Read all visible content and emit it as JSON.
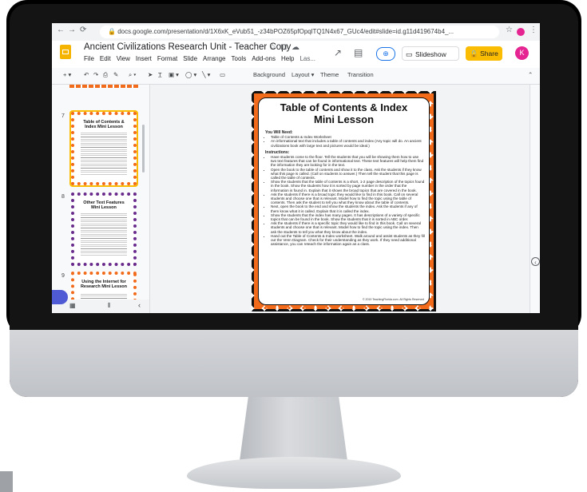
{
  "browser": {
    "url": "docs.google.com/presentation/d/1X6xK_eVub51_-z34bPOZ65pfOpqlTQ1N4x67_GUc4/edit#slide=id.g11d419674b4_...",
    "nav": [
      "←",
      "→",
      "⟳"
    ]
  },
  "app": {
    "title": "Ancient Civilizations Research Unit - Teacher Copy",
    "menu": [
      "File",
      "Edit",
      "View",
      "Insert",
      "Format",
      "Slide",
      "Arrange",
      "Tools",
      "Add-ons",
      "Help",
      "Las..."
    ],
    "slideshow_label": "Slideshow",
    "share_label": "Share",
    "avatar_letter": "K"
  },
  "toolbar": {
    "background": "Background",
    "layout": "Layout ▾",
    "theme": "Theme",
    "transition": "Transition"
  },
  "filmstrip": {
    "slides": [
      {
        "num": "7",
        "title": "Table of Contents & Index Mini Lesson",
        "border": "#f26b1b",
        "selected": true
      },
      {
        "num": "8",
        "title": "Other Text Features Mini Lesson",
        "border": "#6a2c8c",
        "selected": false
      },
      {
        "num": "9",
        "title": "Using the Internet for Research Mini Lesson",
        "border": "#f26b1b",
        "selected": false
      }
    ]
  },
  "slide": {
    "title_line1": "Table of Contents & Index",
    "title_line2": "Mini Lesson",
    "need_heading": "You Will Need:",
    "need_items": [
      "Table of Contents & Index Worksheet",
      "An informational text that includes a table of contents and index (Any topic will do. An ancient civilizations book with large text and pictures would be ideal.)"
    ],
    "instructions_heading": "Instructions:",
    "instructions": [
      "Have students come to the floor. Tell the students that you will be showing them how to use two text features that can be found in informational text. These text features will help them find the information they are looking for in the text.",
      "Open the book to the table of contents and show it to the class. Ask the students if they know what this page is called. (Call on students to answer.) Then tell the student that this page is called the table of contents.",
      "Show the students that the table of contents is a short, 1-2 page description of the topics found in the book. Show the students how it is sorted by page number in the order that the information is found in. Explain that it shows the broad topics that are covered in the book.",
      "Ask the students if there is a broad topic they would like to find in this book. Call on several students and choose one that is relevant. Model how to find the topic using the table of contents. Then ask the student to tell you what they know about the table of contents.",
      "Next, open the book to the end and show the students the index. Ask the students if any of them know what it is called. Explain that it is called the index.",
      "Show the students that the index has many pages. It has descriptions of a variety of specific topics that can be found in the book. Show the students that it is sorted in ABC order.",
      "Ask the students if there is a specific topic they would like to find in this book. Call on several students and choose one that is relevant. Model how to find the topic using the index. Then ask the students to tell you what they know about the index.",
      "Hand out the Table of Contents & Index worksheet. Walk around and assist students as they fill out the Venn Diagram. Check for their understanding as they work. If they need additional assistance, you can reteach the information again as a class."
    ],
    "copyright": "© 2019 TeachingFlorida.com. All Rights Reserved"
  }
}
